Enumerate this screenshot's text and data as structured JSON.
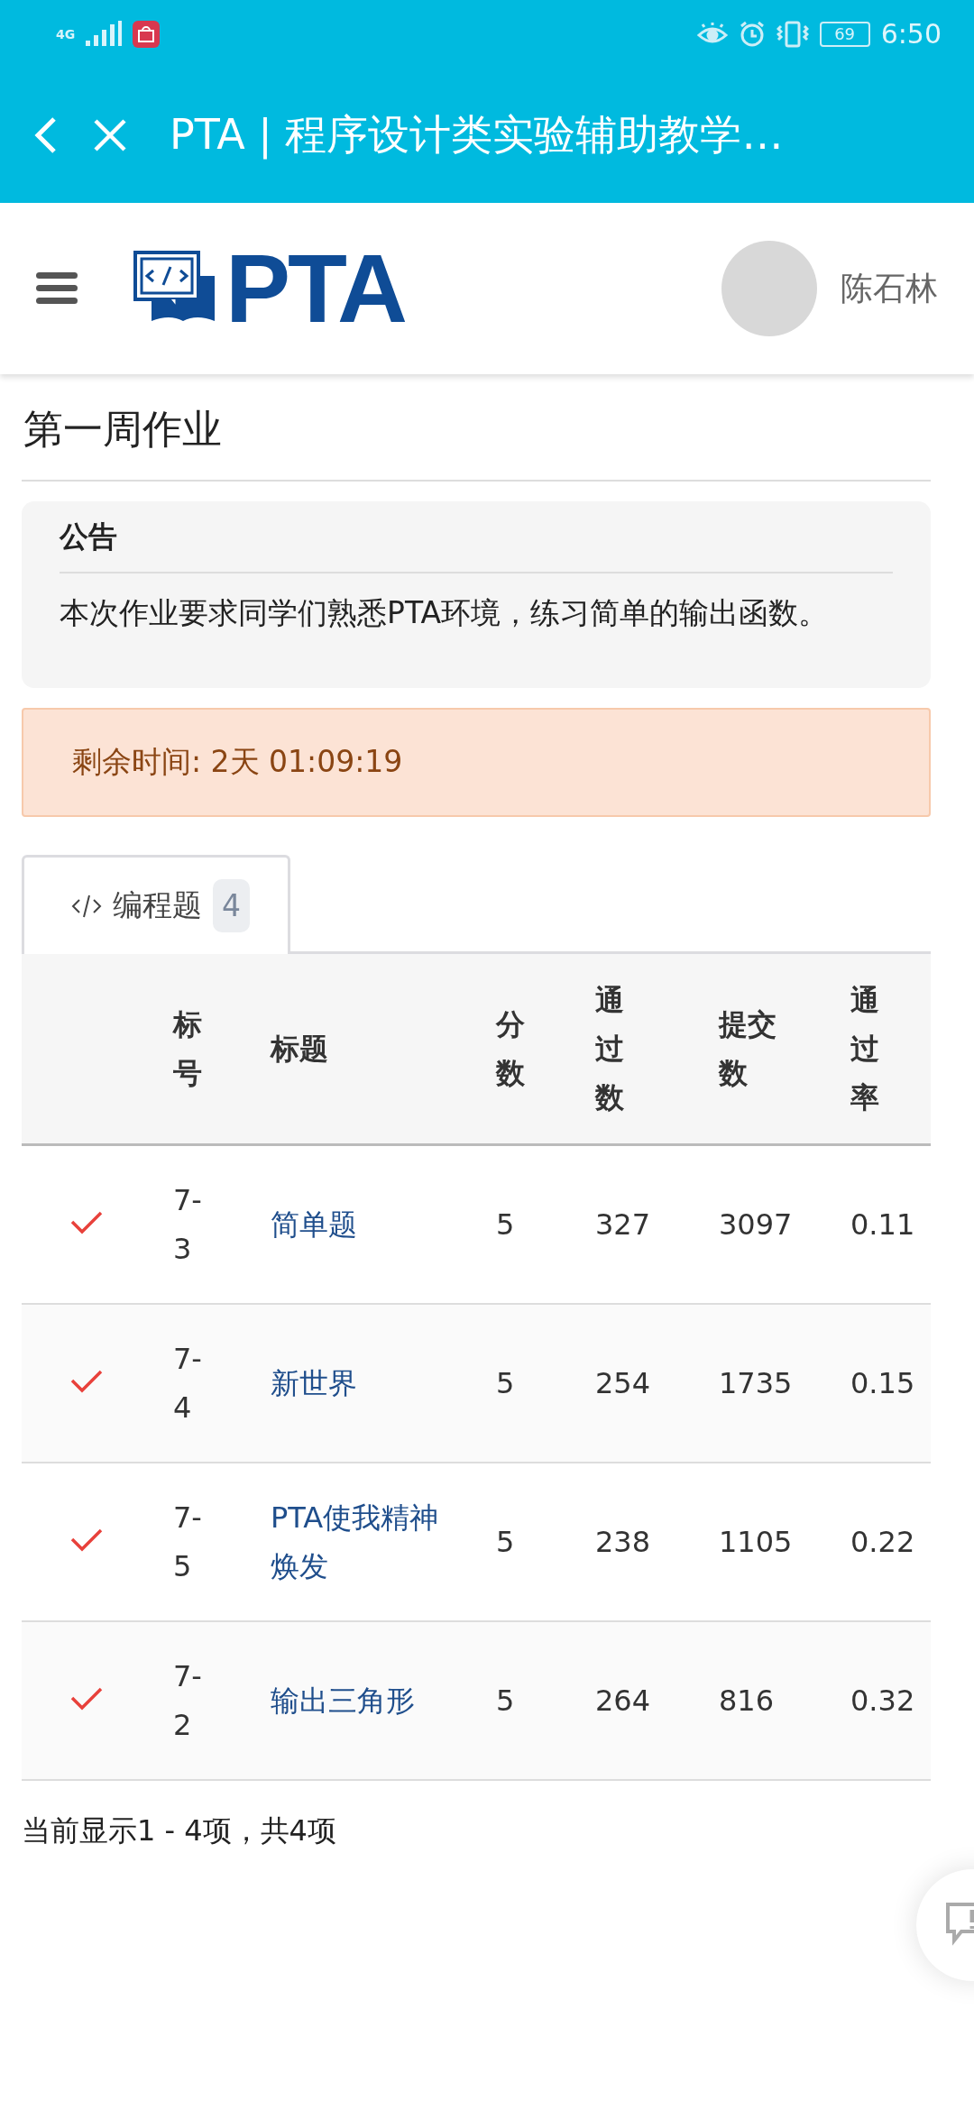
{
  "status_bar": {
    "network": "4G",
    "battery": "69",
    "time": "6:50"
  },
  "app_bar": {
    "title": "PTA | 程序设计类实验辅助教学…"
  },
  "header": {
    "logo": "PTA",
    "user": "陈石林"
  },
  "page_title": "第一周作业",
  "notice": {
    "heading": "公告",
    "text": "本次作业要求同学们熟悉PTA环境，练习简单的输出函数。"
  },
  "alert": {
    "text": "剩余时间: 2天 01:09:19"
  },
  "tabs": [
    {
      "label": "编程题",
      "count": "4",
      "selected": true
    }
  ],
  "table": {
    "columns": [
      "标号",
      "标题",
      "分数",
      "通过数",
      "提交数",
      "通过率"
    ],
    "rows": [
      {
        "passed": true,
        "number": "7-3",
        "title": "简单题",
        "score": "5",
        "accepted": "327",
        "submitted": "3097",
        "rate": "0.11"
      },
      {
        "passed": true,
        "number": "7-4",
        "title": "新世界",
        "score": "5",
        "accepted": "254",
        "submitted": "1735",
        "rate": "0.15"
      },
      {
        "passed": true,
        "number": "7-5",
        "title": "PTA使我精神焕发",
        "score": "5",
        "accepted": "238",
        "submitted": "1105",
        "rate": "0.22"
      },
      {
        "passed": true,
        "number": "7-2",
        "title": "输出三角形",
        "score": "5",
        "accepted": "264",
        "submitted": "816",
        "rate": "0.32"
      }
    ]
  },
  "footer": "当前显示1 - 4项，共4项"
}
